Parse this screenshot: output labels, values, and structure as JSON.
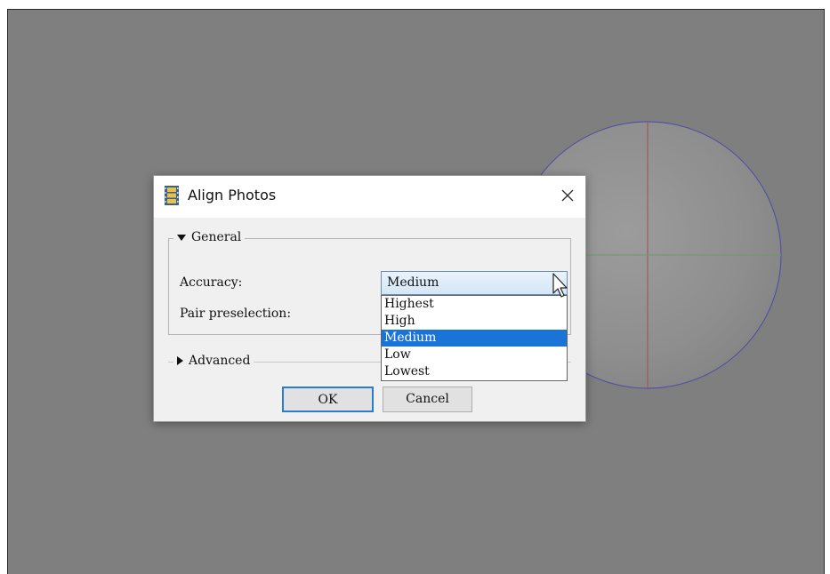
{
  "dialog": {
    "title": "Align Photos",
    "title_icon": "film-strip-icon",
    "close_icon": "close-icon"
  },
  "general": {
    "legend": "General",
    "expanded": true,
    "accuracy_label": "Accuracy:",
    "accuracy_value": "Medium",
    "pair_preselection_label": "Pair preselection:",
    "accuracy_options": [
      "Highest",
      "High",
      "Medium",
      "Low",
      "Lowest"
    ],
    "accuracy_selected": "Medium"
  },
  "advanced": {
    "legend": "Advanced",
    "expanded": false
  },
  "buttons": {
    "ok_label": "OK",
    "cancel_label": "Cancel"
  },
  "colors": {
    "viewport_bg": "#7f7f7f",
    "selection_blue": "#1a73d6",
    "ok_border": "#2a7bd4",
    "sphere_outline": "#4a4aa8",
    "axis_red": "#a05050",
    "axis_green": "#6a9a6a"
  }
}
